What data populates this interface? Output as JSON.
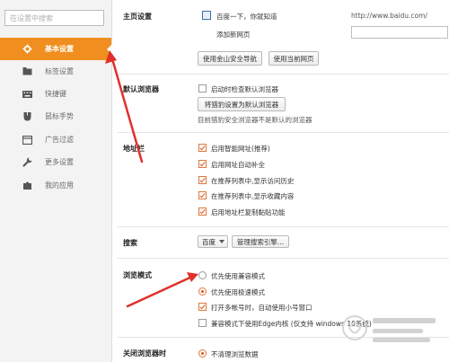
{
  "sidebar": {
    "search_placeholder": "在设置中搜索",
    "items": [
      {
        "label": "基本设置",
        "icon": "gear-icon",
        "active": true
      },
      {
        "label": "标签设置",
        "icon": "tab-icon",
        "active": false
      },
      {
        "label": "快捷键",
        "icon": "keyboard-icon",
        "active": false
      },
      {
        "label": "鼠标手势",
        "icon": "mouse-icon",
        "active": false
      },
      {
        "label": "广告过滤",
        "icon": "filter-icon",
        "active": false
      },
      {
        "label": "更多设置",
        "icon": "wrench-icon",
        "active": false
      },
      {
        "label": "我的应用",
        "icon": "puzzle-icon",
        "active": false
      }
    ]
  },
  "homepage": {
    "title": "主页设置",
    "home_entry": "百度一下，你就知道",
    "home_url": "http://www.baidu.com/",
    "add_new": "添加新网页",
    "btn_safe_nav": "使用金山安全导航",
    "btn_current": "使用当前网页"
  },
  "default_browser": {
    "title": "默认浏览器",
    "check_label": "启动时检查默认浏览器",
    "set_button": "将猎豹设置为默认浏览器",
    "status": "目前猎豹安全浏览器不是默认的浏览器"
  },
  "addressbar": {
    "title": "地址栏",
    "options": [
      {
        "label": "启用智能网址(推荐)",
        "checked": true
      },
      {
        "label": "启用网址自动补全",
        "checked": true
      },
      {
        "label": "在推荐列表中,显示访问历史",
        "checked": true
      },
      {
        "label": "在推荐列表中,显示收藏内容",
        "checked": true
      },
      {
        "label": "启用地址栏复制黏贴功能",
        "checked": true
      }
    ]
  },
  "search": {
    "title": "搜索",
    "engine": "百度",
    "manage_button": "管理搜索引擎..."
  },
  "browse_mode": {
    "title": "浏览模式",
    "radios": [
      {
        "label": "优先使用兼容模式",
        "selected": false
      },
      {
        "label": "优先使用极速模式",
        "selected": true
      }
    ],
    "checks": [
      {
        "label": "打开多帐号时，自动使用小号窗口",
        "checked": true
      },
      {
        "label": "兼容模式下使用Edge内核 (仅支持 windows 10系统)",
        "checked": false
      }
    ]
  },
  "close_browser": {
    "title": "关闭浏览器时",
    "option": "不清理浏览数据"
  },
  "colors": {
    "accent": "#f08f1f",
    "annotation_red": "#e0302a"
  }
}
